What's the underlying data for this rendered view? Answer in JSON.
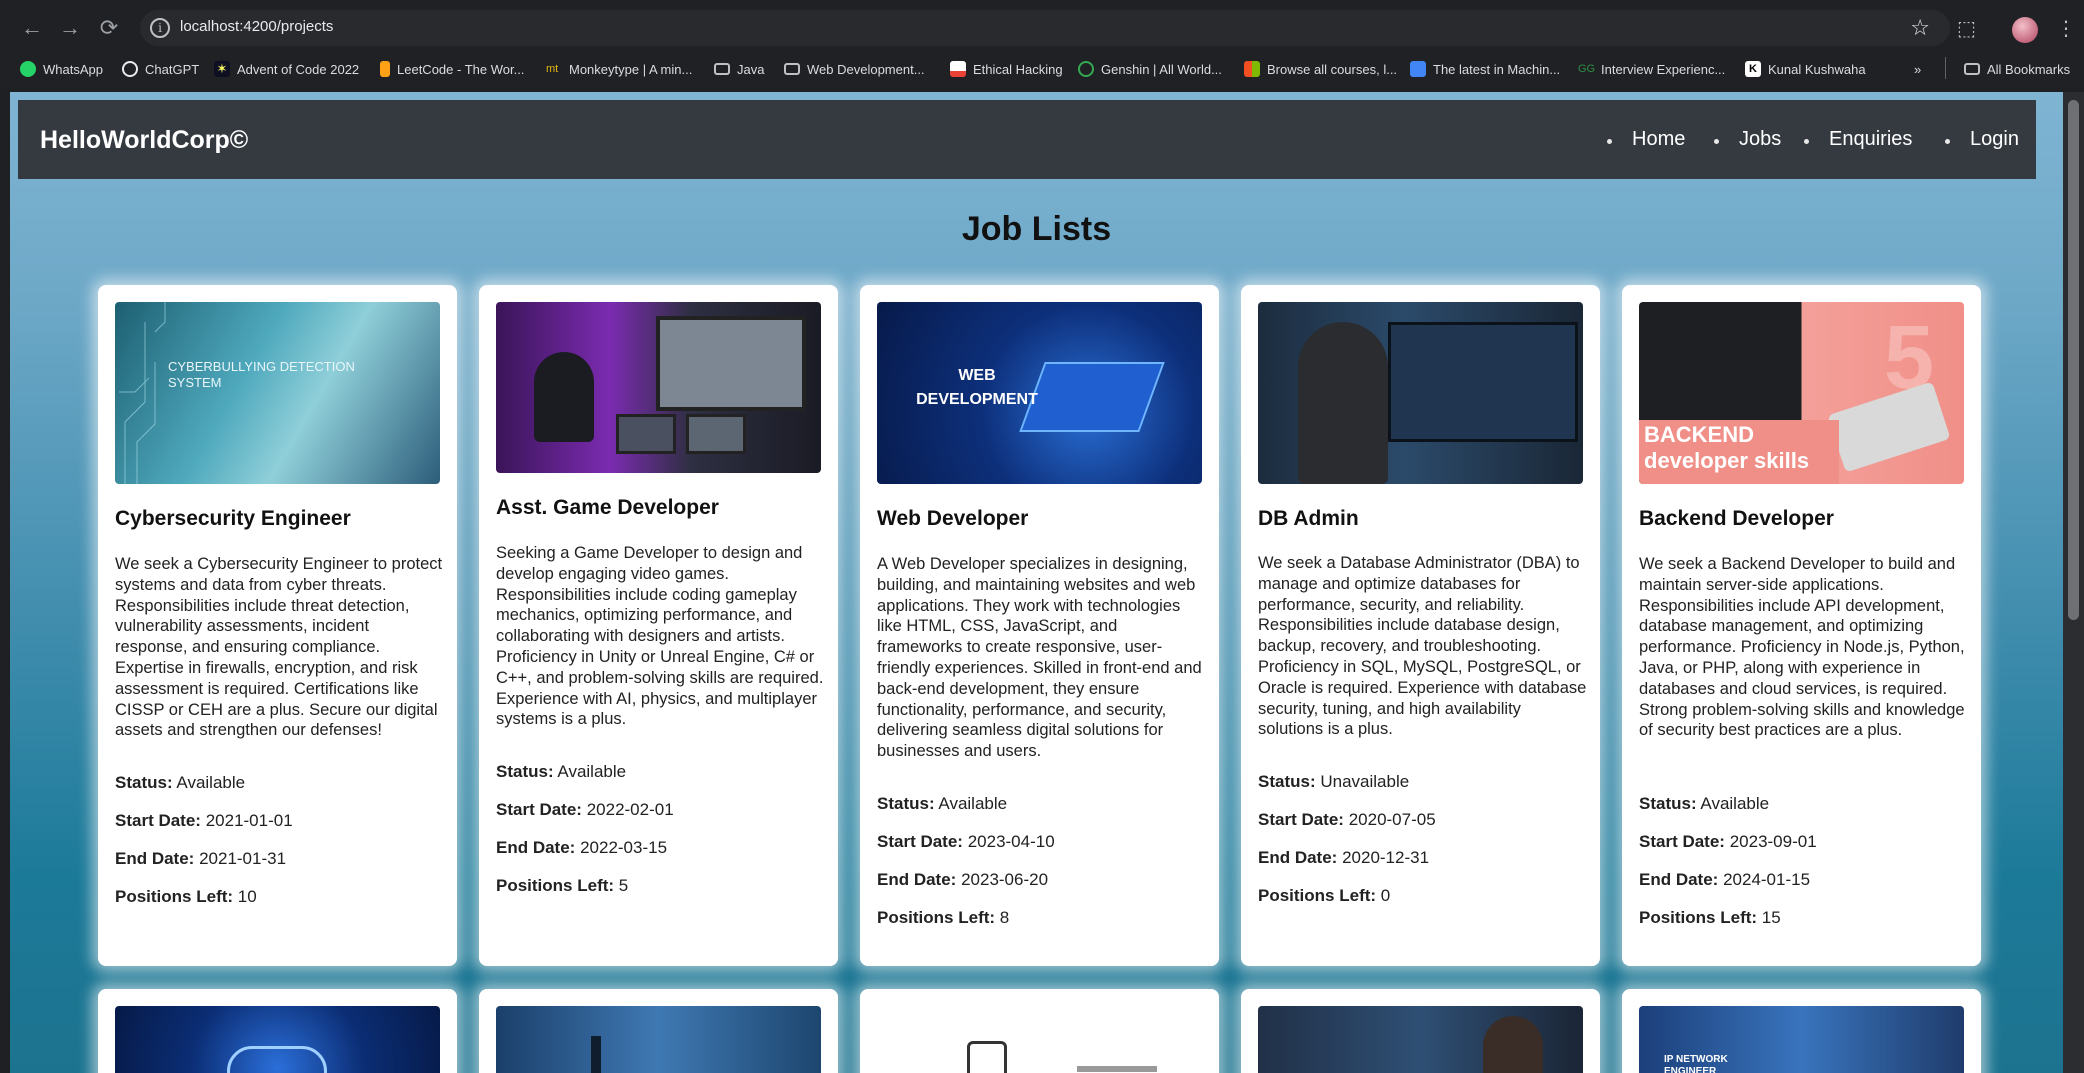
{
  "browser": {
    "url": "localhost:4200/projects",
    "bookmarks": [
      {
        "label": "WhatsApp",
        "color": "#25d366"
      },
      {
        "label": "ChatGPT",
        "color": "#e8eaed"
      },
      {
        "label": "Advent of Code 2022",
        "color": "#ffff66"
      },
      {
        "label": "LeetCode - The Wor...",
        "color": "#ffa116"
      },
      {
        "label": "Monkeytype | A min...",
        "color": "#e2b714"
      },
      {
        "label": "Java",
        "color": "folder"
      },
      {
        "label": "Web Development...",
        "color": "folder"
      },
      {
        "label": "Ethical Hacking",
        "color": "#ea4335"
      },
      {
        "label": "Genshin | All World...",
        "color": "#34a853"
      },
      {
        "label": "Browse all courses, l...",
        "color": "#f25022"
      },
      {
        "label": "The latest in Machin...",
        "color": "#4285f4"
      },
      {
        "label": "Interview Experienc...",
        "color": "#2f8d46"
      },
      {
        "label": "Kunal Kushwaha",
        "color": "#ffffff"
      }
    ],
    "more_label": "»",
    "all_bookmarks_label": "All Bookmarks"
  },
  "navbar": {
    "brand": "HelloWorldCorp©",
    "links": [
      "Home",
      "Jobs",
      "Enquiries",
      "Login"
    ]
  },
  "page": {
    "title": "Job Lists",
    "labels": {
      "status": "Status:",
      "start": "Start Date:",
      "end": "End Date:",
      "positions": "Positions Left:"
    }
  },
  "jobs": [
    {
      "title": "Cybersecurity Engineer",
      "image_caption": "CYBERBULLYING DETECTION SYSTEM",
      "description": "We seek a Cybersecurity Engineer to protect systems and data from cyber threats. Responsibilities include threat detection, vulnerability assessments, incident response, and ensuring compliance. Expertise in firewalls, encryption, and risk assessment is required. Certifications like CISSP or CEH are a plus. Secure our digital assets and strengthen our defenses!",
      "status": "Available",
      "start_date": "2021-01-01",
      "end_date": "2021-01-31",
      "positions_left": "10"
    },
    {
      "title": "Asst. Game Developer",
      "image_caption": "",
      "description": "Seeking a Game Developer to design and develop engaging video games. Responsibilities include coding gameplay mechanics, optimizing performance, and collaborating with designers and artists. Proficiency in Unity or Unreal Engine, C# or C++, and problem-solving skills are required. Experience with AI, physics, and multiplayer systems is a plus.",
      "status": "Available",
      "start_date": "2022-02-01",
      "end_date": "2022-03-15",
      "positions_left": "5"
    },
    {
      "title": "Web Developer",
      "image_caption": "WEB DEVELOPMENT",
      "description": "A Web Developer specializes in designing, building, and maintaining websites and web applications. They work with technologies like HTML, CSS, JavaScript, and frameworks to create responsive, user-friendly experiences. Skilled in front-end and back-end development, they ensure functionality, performance, and security, delivering seamless digital solutions for businesses and users.",
      "status": "Available",
      "start_date": "2023-04-10",
      "end_date": "2023-06-20",
      "positions_left": "8"
    },
    {
      "title": "DB Admin",
      "image_caption": "",
      "description": "We seek a Database Administrator (DBA) to manage and optimize databases for performance, security, and reliability. Responsibilities include database design, backup, recovery, and troubleshooting. Proficiency in SQL, MySQL, PostgreSQL, or Oracle is required. Experience with database security, tuning, and high availability solutions is a plus.",
      "status": "Unavailable",
      "start_date": "2020-07-05",
      "end_date": "2020-12-31",
      "positions_left": "0"
    },
    {
      "title": "Backend Developer",
      "image_caption": "BACKEND developer skills",
      "description": "We seek a Backend Developer to build and maintain server-side applications. Responsibilities include API development, database management, and optimizing performance. Proficiency in Node.js, Python, Java, or PHP, along with experience in databases and cloud services, is required. Strong problem-solving skills and knowledge of security best practices are a plus.",
      "status": "Available",
      "start_date": "2023-09-01",
      "end_date": "2024-01-15",
      "positions_left": "15"
    }
  ],
  "second_row": {
    "image_captions": [
      "IP NETWORK ENGINEER"
    ]
  },
  "colors": {
    "navbar": "#343a40",
    "backdrop_top": "#7fb4d3",
    "backdrop_bottom": "#1c738f"
  }
}
